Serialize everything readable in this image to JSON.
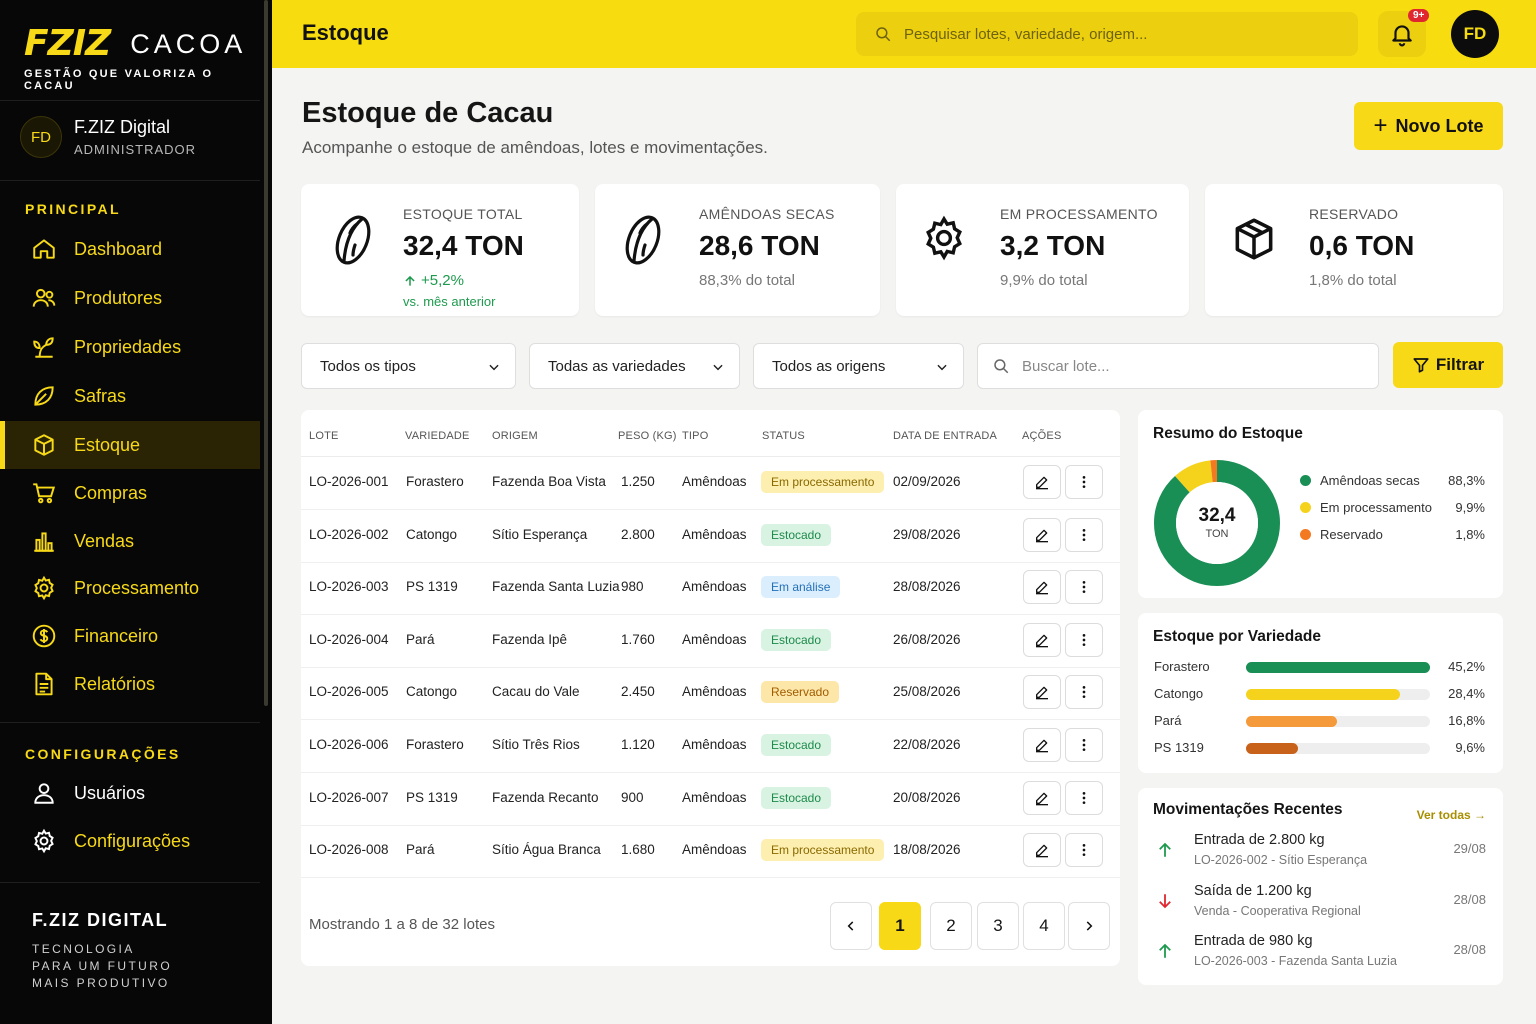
{
  "brand": {
    "mark": "FZIZ",
    "word": "CACOA",
    "tagline": "GESTÃO QUE VALORIZA O CACAU"
  },
  "user": {
    "initials": "FD",
    "name": "F.ZIZ Digital",
    "role": "ADMINISTRADOR"
  },
  "nav": {
    "principal_title": "PRINCIPAL",
    "items": [
      {
        "label": "Dashboard",
        "icon": "home-icon"
      },
      {
        "label": "Produtores",
        "icon": "users-icon"
      },
      {
        "label": "Propriedades",
        "icon": "plant-icon"
      },
      {
        "label": "Safras",
        "icon": "leaf-icon"
      },
      {
        "label": "Estoque",
        "icon": "box-icon",
        "active": true
      },
      {
        "label": "Compras",
        "icon": "cart-icon"
      },
      {
        "label": "Vendas",
        "icon": "bar-chart-icon"
      },
      {
        "label": "Processamento",
        "icon": "gear-icon"
      },
      {
        "label": "Financeiro",
        "icon": "dollar-icon"
      },
      {
        "label": "Relatórios",
        "icon": "report-icon"
      }
    ],
    "config_title": "CONFIGURAÇÕES",
    "config_items": [
      {
        "label": "Usuários",
        "icon": "user-icon"
      },
      {
        "label": "Configurações",
        "icon": "gear-icon"
      }
    ]
  },
  "footer": {
    "title": "F.ZIZ DIGITAL",
    "line1": "TECNOLOGIA",
    "line2": "PARA UM FUTURO",
    "line3": "MAIS PRODUTIVO"
  },
  "topbar": {
    "page_name": "Estoque",
    "search_placeholder": "Pesquisar lotes, variedade, origem...",
    "notif_badge": "9+",
    "avatar": "FD"
  },
  "header": {
    "title": "Estoque de Cacau",
    "subtitle": "Acompanhe o estoque de amêndoas, lotes e movimentações.",
    "new_button": "Novo Lote"
  },
  "cards": [
    {
      "label": "ESTOQUE TOTAL",
      "value": "32,4 TON",
      "growth": "+5,2%",
      "vs": "vs. mês anterior",
      "icon": "cocoa-bean-icon"
    },
    {
      "label": "AMÊNDOAS SECAS",
      "value": "28,6 TON",
      "sub": "88,3% do total",
      "icon": "cocoa-bean-icon"
    },
    {
      "label": "EM PROCESSAMENTO",
      "value": "3,2 TON",
      "sub": "9,9% do total",
      "icon": "gear-icon"
    },
    {
      "label": "RESERVADO",
      "value": "0,6 TON",
      "sub": "1,8% do total",
      "icon": "box-icon"
    }
  ],
  "filters": {
    "type": "Todos os tipos",
    "variety": "Todas as variedades",
    "origin": "Todos as origens",
    "search_placeholder": "Buscar lote...",
    "button": "Filtrar"
  },
  "table": {
    "headers": [
      "LOTE",
      "VARIEDADE",
      "ORIGEM",
      "PESO (KG)",
      "TIPO",
      "STATUS",
      "DATA DE ENTRADA",
      "AÇÕES"
    ],
    "rows": [
      {
        "lote": "LO-2026-001",
        "variedade": "Forastero",
        "origem": "Fazenda Boa Vista",
        "peso": "1.250",
        "tipo": "Amêndoas",
        "status": "Em processamento",
        "status_kind": "processing",
        "data": "02/09/2026"
      },
      {
        "lote": "LO-2026-002",
        "variedade": "Catongo",
        "origem": "Sítio Esperança",
        "peso": "2.800",
        "tipo": "Amêndoas",
        "status": "Estocado",
        "status_kind": "stocked",
        "data": "29/08/2026"
      },
      {
        "lote": "LO-2026-003",
        "variedade": "PS 1319",
        "origem": "Fazenda Santa Luzia",
        "peso": "980",
        "tipo": "Amêndoas",
        "status": "Em análise",
        "status_kind": "analysis",
        "data": "28/08/2026"
      },
      {
        "lote": "LO-2026-004",
        "variedade": "Pará",
        "origem": "Fazenda Ipê",
        "peso": "1.760",
        "tipo": "Amêndoas",
        "status": "Estocado",
        "status_kind": "stocked",
        "data": "26/08/2026"
      },
      {
        "lote": "LO-2026-005",
        "variedade": "Catongo",
        "origem": "Cacau do Vale",
        "peso": "2.450",
        "tipo": "Amêndoas",
        "status": "Reservado",
        "status_kind": "reserved",
        "data": "25/08/2026"
      },
      {
        "lote": "LO-2026-006",
        "variedade": "Forastero",
        "origem": "Sítio Três Rios",
        "peso": "1.120",
        "tipo": "Amêndoas",
        "status": "Estocado",
        "status_kind": "stocked",
        "data": "22/08/2026"
      },
      {
        "lote": "LO-2026-007",
        "variedade": "PS 1319",
        "origem": "Fazenda Recanto",
        "peso": "900",
        "tipo": "Amêndoas",
        "status": "Estocado",
        "status_kind": "stocked",
        "data": "20/08/2026"
      },
      {
        "lote": "LO-2026-008",
        "variedade": "Pará",
        "origem": "Sítio Água Branca",
        "peso": "1.680",
        "tipo": "Amêndoas",
        "status": "Em processamento",
        "status_kind": "processing",
        "data": "18/08/2026"
      }
    ],
    "showing": "Mostrando 1 a 8 de 32 lotes",
    "pages": [
      "1",
      "2",
      "3",
      "4"
    ],
    "current_page": "1"
  },
  "status_colors": {
    "processing": {
      "bg": "#fdefb0",
      "fg": "#8a6a00"
    },
    "stocked": {
      "bg": "#d9f3e3",
      "fg": "#1d8a4a"
    },
    "analysis": {
      "bg": "#dbeefd",
      "fg": "#2470b8"
    },
    "reserved": {
      "bg": "#fde7a8",
      "fg": "#a05c00"
    }
  },
  "summary": {
    "title": "Resumo do Estoque",
    "center_value": "32,4",
    "center_unit": "TON",
    "items": [
      {
        "label": "Amêndoas secas",
        "value": "88,3%",
        "percent": 88.3,
        "color": "#1a8f55"
      },
      {
        "label": "Em processamento",
        "value": "9,9%",
        "percent": 9.9,
        "color": "#f5d31c"
      },
      {
        "label": "Reservado",
        "value": "1,8%",
        "percent": 1.8,
        "color": "#f47a22"
      }
    ]
  },
  "variety": {
    "title": "Estoque por Variedade",
    "items": [
      {
        "label": "Forastero",
        "value": "45,2%",
        "percent": 45.2,
        "color": "#1a8f55"
      },
      {
        "label": "Catongo",
        "value": "28,4%",
        "percent": 28.4,
        "color": "#f5d31c"
      },
      {
        "label": "Pará",
        "value": "16,8%",
        "percent": 16.8,
        "color": "#f59a3a"
      },
      {
        "label": "PS 1319",
        "value": "9,6%",
        "percent": 9.6,
        "color": "#c8621a"
      }
    ]
  },
  "movements": {
    "title": "Movimentações Recentes",
    "see_all": "Ver todas →",
    "items": [
      {
        "title": "Entrada de 2.800 kg",
        "sub": "LO-2026-002 - Sítio Esperança",
        "date": "29/08",
        "direction": "in"
      },
      {
        "title": "Saída de 1.200 kg",
        "sub": "Venda - Cooperativa Regional",
        "date": "28/08",
        "direction": "out"
      },
      {
        "title": "Entrada de 980 kg",
        "sub": "LO-2026-003 - Fazenda Santa Luzia",
        "date": "28/08",
        "direction": "in"
      }
    ]
  }
}
